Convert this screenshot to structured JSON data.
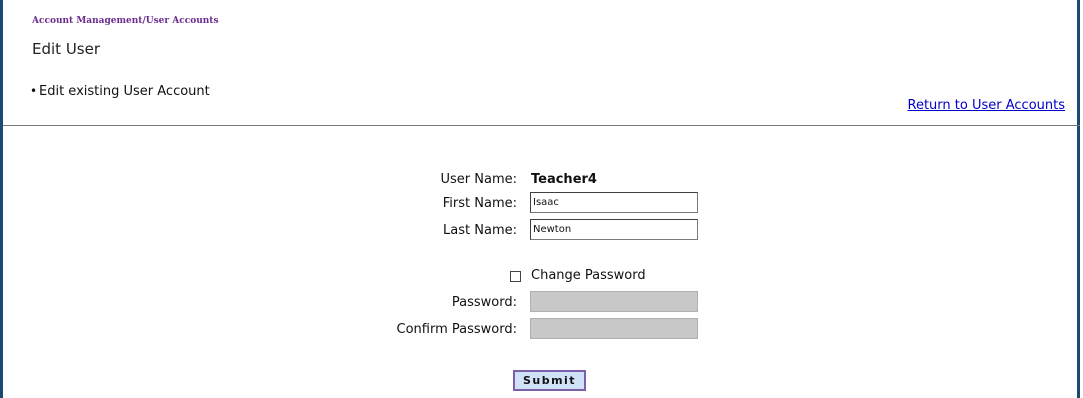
{
  "breadcrumb": "Account Management/User Accounts",
  "page_title": "Edit User",
  "instructions": [
    "Edit existing User Account"
  ],
  "return_link": "Return to User Accounts",
  "form": {
    "username_label": "User Name:",
    "username_value": "Teacher4",
    "first_name_label": "First Name:",
    "first_name_value": "Isaac",
    "last_name_label": "Last Name:",
    "last_name_value": "Newton",
    "change_password_label": "Change Password",
    "change_password_checked": false,
    "password_label": "Password:",
    "password_value": "",
    "confirm_password_label": "Confirm Password:",
    "confirm_password_value": "",
    "submit_label": "Submit"
  },
  "colors": {
    "frame_border": "#1a4a72",
    "breadcrumb": "#6b2c8f",
    "link": "#0000cc",
    "submit_bg": "#cfe2f7",
    "submit_border": "#7b5fa8",
    "disabled_field": "#c8c8c8"
  }
}
